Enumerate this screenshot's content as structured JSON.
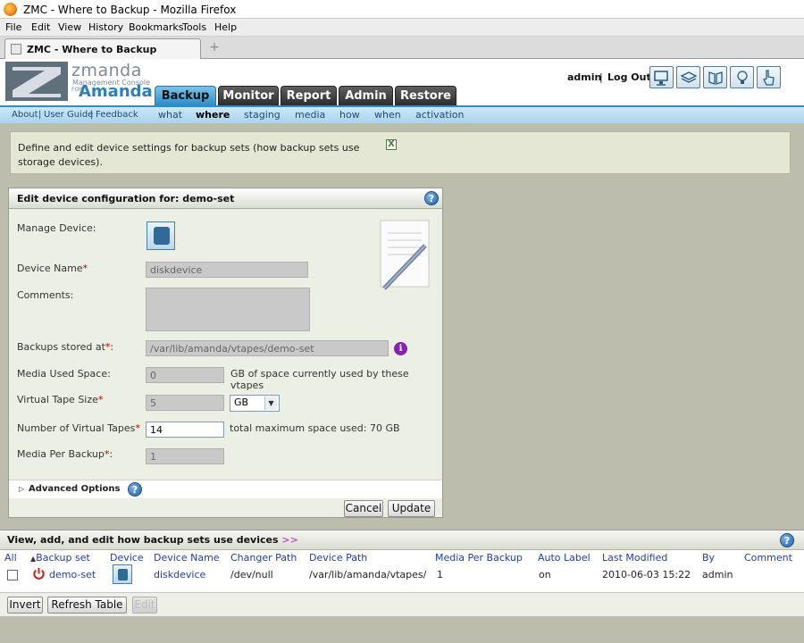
{
  "window": {
    "title": "ZMC - Where to Backup - Mozilla Firefox"
  },
  "menubar": [
    "File",
    "Edit",
    "View",
    "History",
    "Bookmarks",
    "Tools",
    "Help"
  ],
  "browser_tab": {
    "label": "ZMC - Where to Backup",
    "new_tab": "+"
  },
  "logo": {
    "name": "zmanda",
    "subtitle": "Management Console",
    "for": "FOR",
    "product": "Amanda"
  },
  "nav_tabs": [
    "Backup",
    "Monitor",
    "Report",
    "Admin",
    "Restore"
  ],
  "active_nav_tab": "Backup",
  "user": {
    "name": "admin",
    "separator": "|",
    "logout": "Log Out"
  },
  "toolbar_icons": [
    "monitor-icon",
    "stack-icon",
    "book-icon",
    "lightbulb-icon",
    "pointer-hand-icon"
  ],
  "sub_links": [
    "About",
    "User Guide",
    "Feedback"
  ],
  "sub_link_separators": [
    "|",
    "|"
  ],
  "sub_tabs": [
    "what",
    "where",
    "staging",
    "media",
    "how",
    "when",
    "activation"
  ],
  "active_sub_tab": "where",
  "info": {
    "text": "Define and edit device settings for backup sets (how backup sets use storage devices).",
    "close": "X"
  },
  "edit_panel": {
    "title": "Edit device configuration for: demo-set",
    "help": "?",
    "manage_device_label": "Manage Device:",
    "device_name_label": "Device Name",
    "device_name_value": "diskdevice",
    "comments_label": "Comments:",
    "comments_value": "",
    "backups_stored_label": "Backups stored at",
    "backups_stored_value": "/var/lib/amanda/vtapes/demo-set",
    "info_icon": "i",
    "media_used_label": "Media Used Space:",
    "media_used_value": "0",
    "media_used_suffix": "GB of space currently used by these vtapes",
    "vtape_size_label": "Virtual Tape Size",
    "vtape_size_value": "5",
    "vtape_size_unit": "GB",
    "num_vtapes_label": "Number of Virtual Tapes",
    "num_vtapes_value": "14",
    "num_vtapes_suffix": "total maximum space used: 70 GB",
    "media_per_backup_label": "Media Per Backup",
    "media_per_backup_value": "1",
    "required_mark": "*",
    "label_colon": ":",
    "advanced_arrow": "▷",
    "advanced_label": "Advanced Options",
    "cancel": "Cancel",
    "update": "Update"
  },
  "table_panel": {
    "title": "View, add, and edit how backup sets use devices",
    "more": ">>",
    "help": "?",
    "columns": [
      "All",
      "Backup set",
      "Device",
      "Device Name",
      "Changer Path",
      "Device Path",
      "Media Per Backup",
      "Auto Label",
      "Last Modified",
      "By",
      "Comment"
    ],
    "sort_arrow": "▲",
    "rows": [
      {
        "backup_set": "demo-set",
        "device_name": "diskdevice",
        "changer_path": "/dev/null",
        "device_path": "/var/lib/amanda/vtapes/",
        "media_per_backup": "1",
        "auto_label": "on",
        "last_modified": "2010-06-03 15:22",
        "by": "admin",
        "comment": ""
      }
    ],
    "buttons": {
      "invert": "Invert",
      "refresh": "Refresh Table",
      "edit": "Edit"
    }
  }
}
